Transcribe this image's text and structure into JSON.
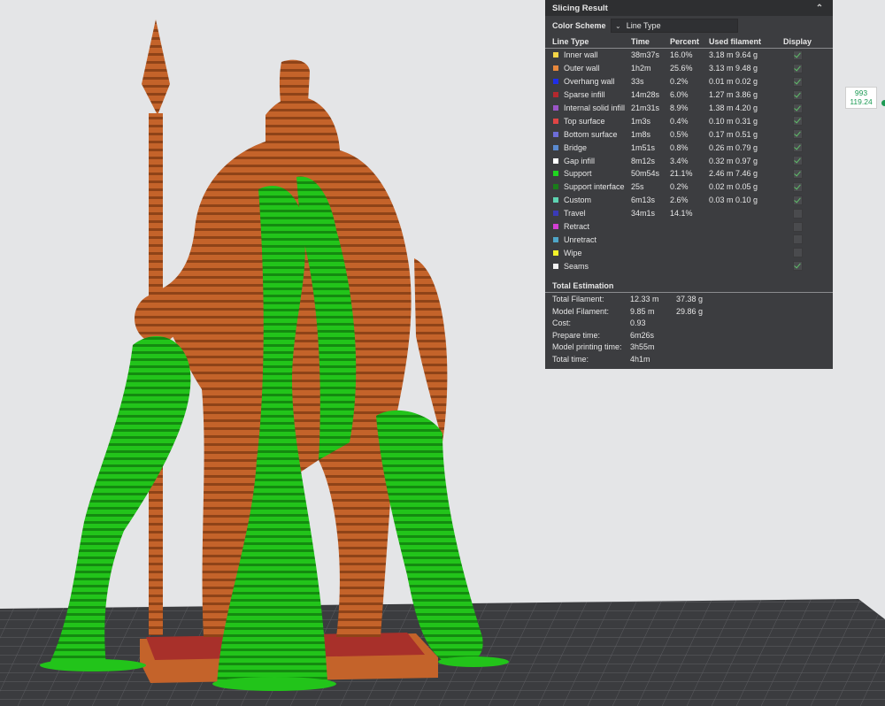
{
  "panel": {
    "title": "Slicing Result",
    "color_scheme_label": "Color Scheme",
    "color_scheme_value": "Line Type",
    "headers": {
      "type": "Line Type",
      "time": "Time",
      "percent": "Percent",
      "filament": "Used filament",
      "display": "Display"
    },
    "rows": [
      {
        "label": "Inner wall",
        "color": "#f5d547",
        "time": "38m37s",
        "percent": "16.0%",
        "filament": "3.18 m  9.64 g",
        "display": true
      },
      {
        "label": "Outer wall",
        "color": "#e8883c",
        "time": "1h2m",
        "percent": "25.6%",
        "filament": "3.13 m  9.48 g",
        "display": true
      },
      {
        "label": "Overhang wall",
        "color": "#1f2ee8",
        "time": "33s",
        "percent": "0.2%",
        "filament": "0.01 m  0.02 g",
        "display": true
      },
      {
        "label": "Sparse infill",
        "color": "#b5282e",
        "time": "14m28s",
        "percent": "6.0%",
        "filament": "1.27 m  3.86 g",
        "display": true
      },
      {
        "label": "Internal solid infill",
        "color": "#9a55c6",
        "time": "21m31s",
        "percent": "8.9%",
        "filament": "1.38 m  4.20 g",
        "display": true
      },
      {
        "label": "Top surface",
        "color": "#e04545",
        "time": "1m3s",
        "percent": "0.4%",
        "filament": "0.10 m  0.31 g",
        "display": true
      },
      {
        "label": "Bottom surface",
        "color": "#6d6dd8",
        "time": "1m8s",
        "percent": "0.5%",
        "filament": "0.17 m  0.51 g",
        "display": true
      },
      {
        "label": "Bridge",
        "color": "#5a8ad0",
        "time": "1m51s",
        "percent": "0.8%",
        "filament": "0.26 m  0.79 g",
        "display": true
      },
      {
        "label": "Gap infill",
        "color": "#ffffff",
        "time": "8m12s",
        "percent": "3.4%",
        "filament": "0.32 m  0.97 g",
        "display": true
      },
      {
        "label": "Support",
        "color": "#1fd61f",
        "time": "50m54s",
        "percent": "21.1%",
        "filament": "2.46 m  7.46 g",
        "display": true
      },
      {
        "label": "Support interface",
        "color": "#1a7d1a",
        "time": "25s",
        "percent": "0.2%",
        "filament": "0.02 m  0.05 g",
        "display": true
      },
      {
        "label": "Custom",
        "color": "#5ed4b2",
        "time": "6m13s",
        "percent": "2.6%",
        "filament": "0.03 m  0.10 g",
        "display": true
      },
      {
        "label": "Travel",
        "color": "#3a3ab8",
        "time": "34m1s",
        "percent": "14.1%",
        "filament": "",
        "display": false
      },
      {
        "label": "Retract",
        "color": "#d33fd3",
        "time": "",
        "percent": "",
        "filament": "",
        "display": false
      },
      {
        "label": "Unretract",
        "color": "#4fa6c8",
        "time": "",
        "percent": "",
        "filament": "",
        "display": false
      },
      {
        "label": "Wipe",
        "color": "#f2f22a",
        "time": "",
        "percent": "",
        "filament": "",
        "display": false
      },
      {
        "label": "Seams",
        "color": "#f2f2f2",
        "time": "",
        "percent": "",
        "filament": "",
        "display": true
      }
    ],
    "estimation_title": "Total Estimation",
    "estimation": [
      {
        "label": "Total Filament:",
        "a": "12.33 m",
        "b": "37.38 g"
      },
      {
        "label": "Model Filament:",
        "a": "9.85 m",
        "b": "29.86 g"
      },
      {
        "label": "Cost:",
        "a": "0.93",
        "b": ""
      },
      {
        "label": "Prepare time:",
        "a": "6m26s",
        "b": ""
      },
      {
        "label": "Model printing time:",
        "a": "3h55m",
        "b": ""
      },
      {
        "label": "Total time:",
        "a": "4h1m",
        "b": ""
      }
    ]
  },
  "layer_slider": {
    "layer": "993",
    "height": "119.24"
  },
  "colors": {
    "model": "#c4632a",
    "support": "#22c41a",
    "plate": "#3b3c3f",
    "raft": "#a8302a"
  }
}
